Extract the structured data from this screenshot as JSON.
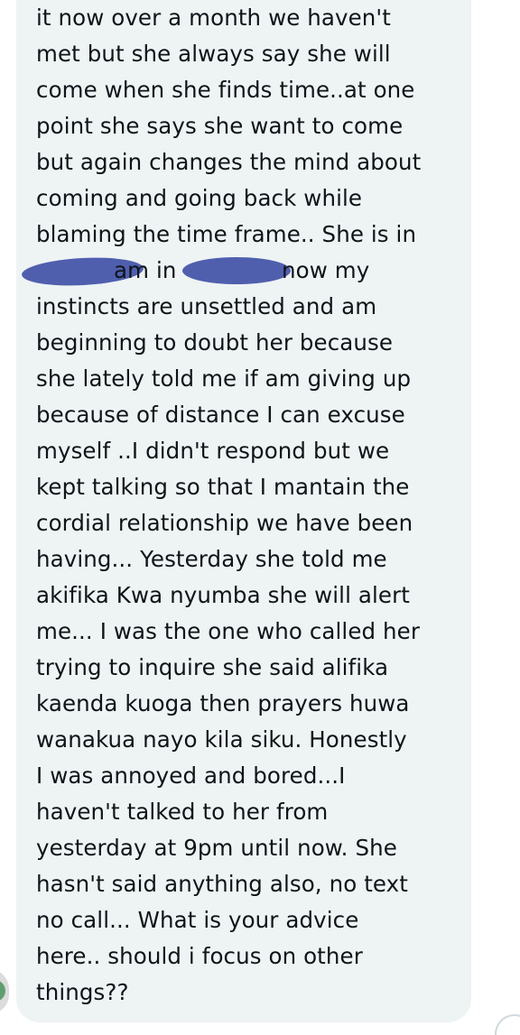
{
  "message": {
    "lines": [
      "it now over a month we haven't",
      "met but she always say she will",
      "come when she finds time..at one",
      "point she says she want to come",
      "but again changes the mind about",
      "coming and going back while",
      "blaming the time frame.. She is in",
      {
        "after_first_redaction": "am in",
        "after_second_redaction": "now my"
      },
      "instincts are unsettled and am",
      "beginning to doubt her because",
      "she lately told me if am giving up",
      "because of distance I can excuse",
      "myself ..I didn't respond but we",
      "kept talking so that I mantain the",
      "cordial relationship we have been",
      "having... Yesterday she told me",
      "akifika Kwa nyumba she will alert",
      "me... I was the one who called her",
      "trying to inquire she said alifika",
      "kaenda kuoga then prayers huwa",
      "wanakua nayo kila siku. Honestly",
      "I was annoyed and bored...I",
      "haven't talked to her from",
      "yesterday at 9pm until now. She",
      "hasn't said anything also, no text",
      "no call... What is your advice",
      "here.. should i focus on other",
      "things??"
    ]
  },
  "colors": {
    "bubble_background": "#eef3f4",
    "text": "#0f1419",
    "redaction": "#4f5fae"
  }
}
